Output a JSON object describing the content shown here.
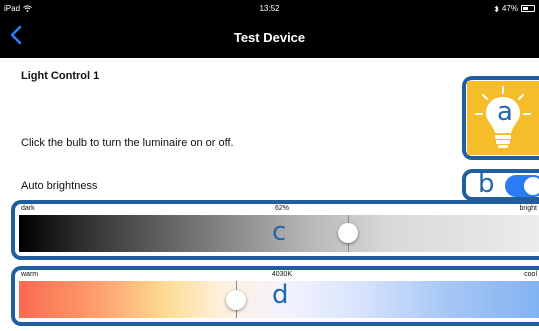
{
  "status_bar": {
    "device": "iPad",
    "time": "13:52",
    "battery": "47%",
    "battery_level": 0.47
  },
  "nav": {
    "title": "Test Device"
  },
  "section": {
    "title": "Light Control 1"
  },
  "hint": "Click the bulb to turn the luminaire on or off.",
  "auto_brightness": {
    "label": "Auto brightness",
    "enabled": true
  },
  "brightness": {
    "min_label": "dark",
    "max_label": "bright",
    "value_label": "62%",
    "value": 0.62
  },
  "color_temperature": {
    "min_label": "warm",
    "max_label": "cool",
    "value_label": "4030K",
    "position": 0.41
  },
  "callouts": {
    "a": "a",
    "b": "b",
    "c": "c",
    "d": "d"
  },
  "colors": {
    "accent": "#2a7bf4",
    "bulb_bg": "#f6bd2b",
    "frame": "#1f5fa0",
    "callout": "#2467ab"
  }
}
